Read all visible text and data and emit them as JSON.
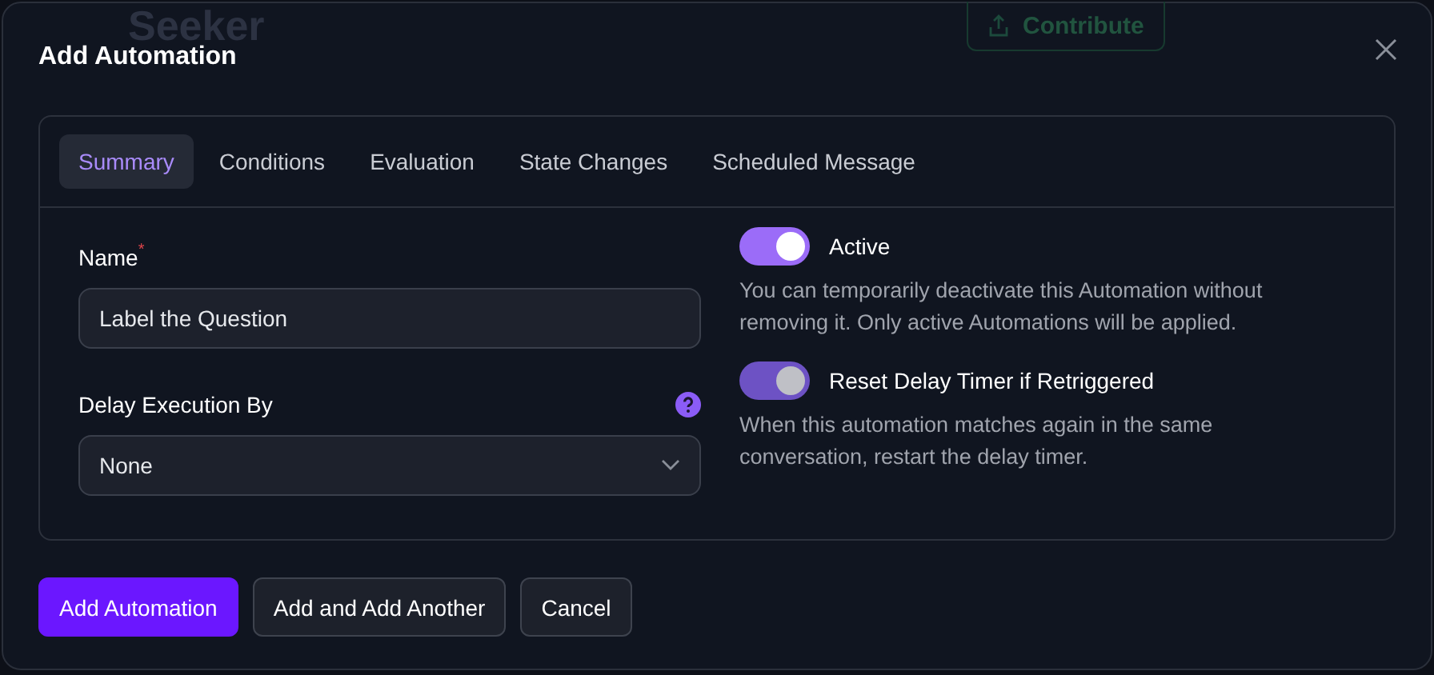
{
  "backdrop": {
    "logo": "Seeker",
    "contribute_button": "Contribute"
  },
  "dialog": {
    "title": "Add Automation",
    "tabs": [
      {
        "label": "Summary",
        "selected": true
      },
      {
        "label": "Conditions",
        "selected": false
      },
      {
        "label": "Evaluation",
        "selected": false
      },
      {
        "label": "State Changes",
        "selected": false
      },
      {
        "label": "Scheduled Message",
        "selected": false
      }
    ],
    "name_field": {
      "label": "Name",
      "required_mark": "*",
      "value": "Label the Question"
    },
    "delay_field": {
      "label": "Delay Execution By",
      "value": "None"
    },
    "toggles": [
      {
        "label": "Active",
        "on": true,
        "disabled": false,
        "description": "You can temporarily deactivate this Automation without removing it. Only active Automations will be applied."
      },
      {
        "label": "Reset Delay Timer if Retriggered",
        "on": true,
        "disabled": true,
        "description": "When this automation matches again in the same conversation, restart the delay timer."
      }
    ],
    "buttons": [
      {
        "label": "Add Automation",
        "kind": "primary"
      },
      {
        "label": "Add and Add Another",
        "kind": "secondary"
      },
      {
        "label": "Cancel",
        "kind": "secondary"
      }
    ]
  }
}
